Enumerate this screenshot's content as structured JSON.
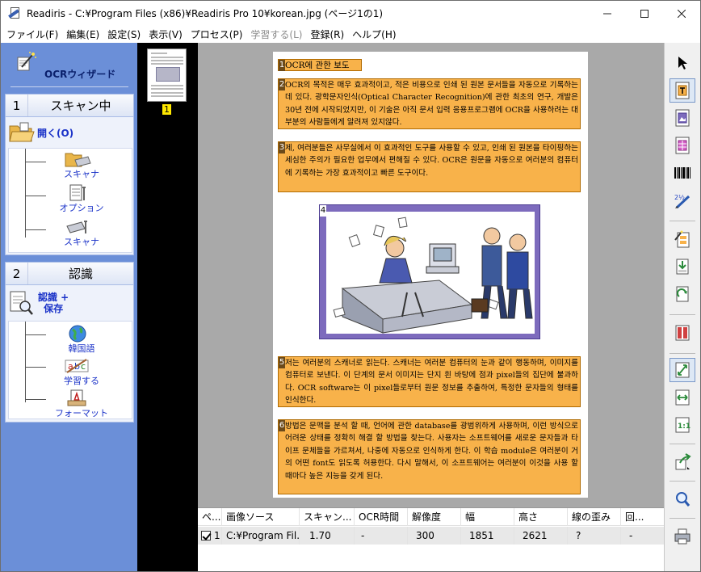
{
  "window": {
    "title": "Readiris - C:¥Program Files (x86)¥Readiris Pro 10¥korean.jpg (ページ1の1)",
    "controls": {
      "minimize": "—",
      "maximize": "☐",
      "close": "✕"
    }
  },
  "menu": [
    {
      "label": "ファイル(F)",
      "enabled": true
    },
    {
      "label": "編集(E)",
      "enabled": true
    },
    {
      "label": "設定(S)",
      "enabled": true
    },
    {
      "label": "表示(V)",
      "enabled": true
    },
    {
      "label": "プロセス(P)",
      "enabled": true
    },
    {
      "label": "学習する(L)",
      "enabled": false
    },
    {
      "label": "登録(R)",
      "enabled": true
    },
    {
      "label": "ヘルプ(H)",
      "enabled": true
    }
  ],
  "wizard": {
    "title": "OCRウィザード",
    "sections": [
      {
        "number": "1",
        "label": "スキャン中",
        "main_action": "開く(O)",
        "sub_items": [
          "スキャナ",
          "オプション",
          "スキャナ"
        ]
      },
      {
        "number": "2",
        "label": "認識",
        "main_action": "認識 +\n保存",
        "sub_items": [
          "韓国語",
          "学習する",
          "フォーマット"
        ]
      }
    ]
  },
  "thumbnail": {
    "page_number": "1"
  },
  "document": {
    "zones": [
      {
        "num": "1",
        "text": "OCR에 관한 보도"
      },
      {
        "num": "2",
        "text": "OCR의 목적은 매우 효과적이고, 적은 비용으로 인쇄 된 원본 문서들을 자동으로 기록하는데 있다. 광학문자인식(Optical Character Recognition)에 관한 최초의 연구, 개발은 30년 전에 시작되었지만, 이 기술은 아직 문서 입력 응용프로그램에 OCR을 사용하려는 대부분의 사람들에게 알려져 있지않다."
      },
      {
        "num": "3",
        "text": "제, 여러분들은 사무실에서 이 효과적인 도구를 사용할 수 있고, 인쇄 된 원본을 타이핑하는 세심한 주의가 필요한 업무에서 편해질 수 있다. OCR은 원문을 자동으로 여러분의 컴퓨터에 기록하는 가장 효과적이고 빠른 도구이다."
      },
      {
        "num": "4",
        "text": ""
      },
      {
        "num": "5",
        "text": "저는 여러분의 스캐너로 읽는다. 스캐너는 여러분 컴퓨터의 눈과 같이 행동하며, 이미지를 컴퓨터로 보낸다. 이 단계의 문서 이미지는 단지 흰 바탕에 점과 pixel들의 집단에 불과하다. OCR software는 이 pixel들로부터 원문 정보를 추출하여, 특정한 문자들의 형태를 인식한다."
      },
      {
        "num": "6",
        "text": "방법은 문맥을 분석 할 때, 언어에 관한 database를 광범위하게 사용하며, 이런 방식으로 어려운 상태를 정확히 해결 할 방법을 찾는다. 사용자는 소프트웨어를 새로운 문자들과 타이프 문체들을 가르쳐서, 나중에 자동으로 인식하게 한다. 이 학습 module은 여러분이 거의 어떤 font도 읽도록 허용한다. 다시 말해서, 이 소프트웨어는 여러분이 이것을 사용 할 때마다 높은 지능을 갖게 된다."
      }
    ]
  },
  "table": {
    "columns": [
      "ペ...",
      "画像ソース",
      "スキャン...",
      "OCR時間",
      "解像度",
      "幅",
      "高さ",
      "線の歪み",
      "回..."
    ],
    "rows": [
      {
        "checked": true,
        "page": "1",
        "source": "C:¥Program Fil...",
        "scan": "1.70",
        "ocr_time": "-",
        "resolution": "300",
        "width": "1851",
        "height": "2621",
        "skew": "?",
        "rotation": "-"
      }
    ]
  },
  "colors": {
    "wizard_bg": "#6b8fd8",
    "zone_fill": "#f8b24a",
    "image_zone": "#7d6bbd",
    "link_blue": "#1a32c8",
    "thumb_badge": "#ffe800"
  }
}
